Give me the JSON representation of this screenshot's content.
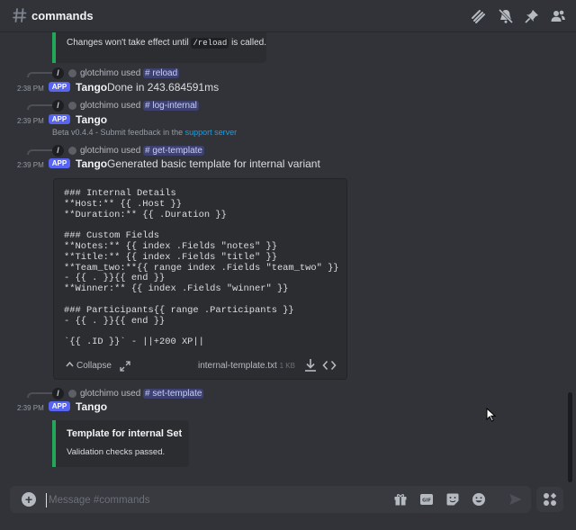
{
  "header": {
    "channel_name": "commands",
    "icons": [
      "hash-icon",
      "threads-icon",
      "notifications-muted-icon",
      "pin-icon",
      "member-list-icon"
    ]
  },
  "messages": {
    "embed_top": {
      "text_before": "Changes won't take effect until ",
      "code": "/reload",
      "text_after": " is called."
    },
    "m1": {
      "ref_user": "glotchimo used ",
      "ref_command": "# reload",
      "timestamp": "2:38 PM",
      "badge": "APP",
      "author": "Tango",
      "content": "Done in 243.684591ms"
    },
    "m2": {
      "ref_user": "glotchimo used ",
      "ref_command": "# log-internal",
      "timestamp": "2:39 PM",
      "badge": "APP",
      "author": "Tango",
      "beta_text": "Beta v0.4.4 - Submit feedback in the ",
      "beta_link": "support server"
    },
    "m3": {
      "ref_user": "glotchimo used ",
      "ref_command": "# get-template",
      "timestamp": "2:39 PM",
      "badge": "APP",
      "author": "Tango",
      "content": "Generated basic template for internal variant",
      "code_block": {
        "lines": "### Internal Details\n**Host:** {{ .Host }}\n**Duration:** {{ .Duration }}\n\n### Custom Fields\n**Notes:** {{ index .Fields \"notes\" }}\n**Title:** {{ index .Fields \"title\" }}\n**Team_two:**{{ range index .Fields \"team_two\" }}\n- {{ . }}{{ end }}\n**Winner:** {{ index .Fields \"winner\" }}\n\n### Participants{{ range .Participants }}\n- {{ . }}{{ end }}\n\n`{{ .ID }}` - ||+200 XP||",
        "collapse_label": "Collapse",
        "file_name": "internal-template.txt",
        "file_size": "1 KB"
      }
    },
    "m4": {
      "ref_user": "glotchimo used ",
      "ref_command": "# set-template",
      "timestamp": "2:39 PM",
      "badge": "APP",
      "author": "Tango",
      "embed_title": "Template for internal Set",
      "embed_desc": "Validation checks passed."
    }
  },
  "composer": {
    "placeholder": "Message #commands",
    "icons": [
      "add-icon",
      "gift-icon",
      "gif-icon",
      "sticker-icon",
      "emoji-icon",
      "send-icon",
      "apps-icon"
    ]
  },
  "colors": {
    "background": "#313338",
    "accent": "#5865f2",
    "embed_border": "#23a55a",
    "link": "#00a8fc"
  }
}
